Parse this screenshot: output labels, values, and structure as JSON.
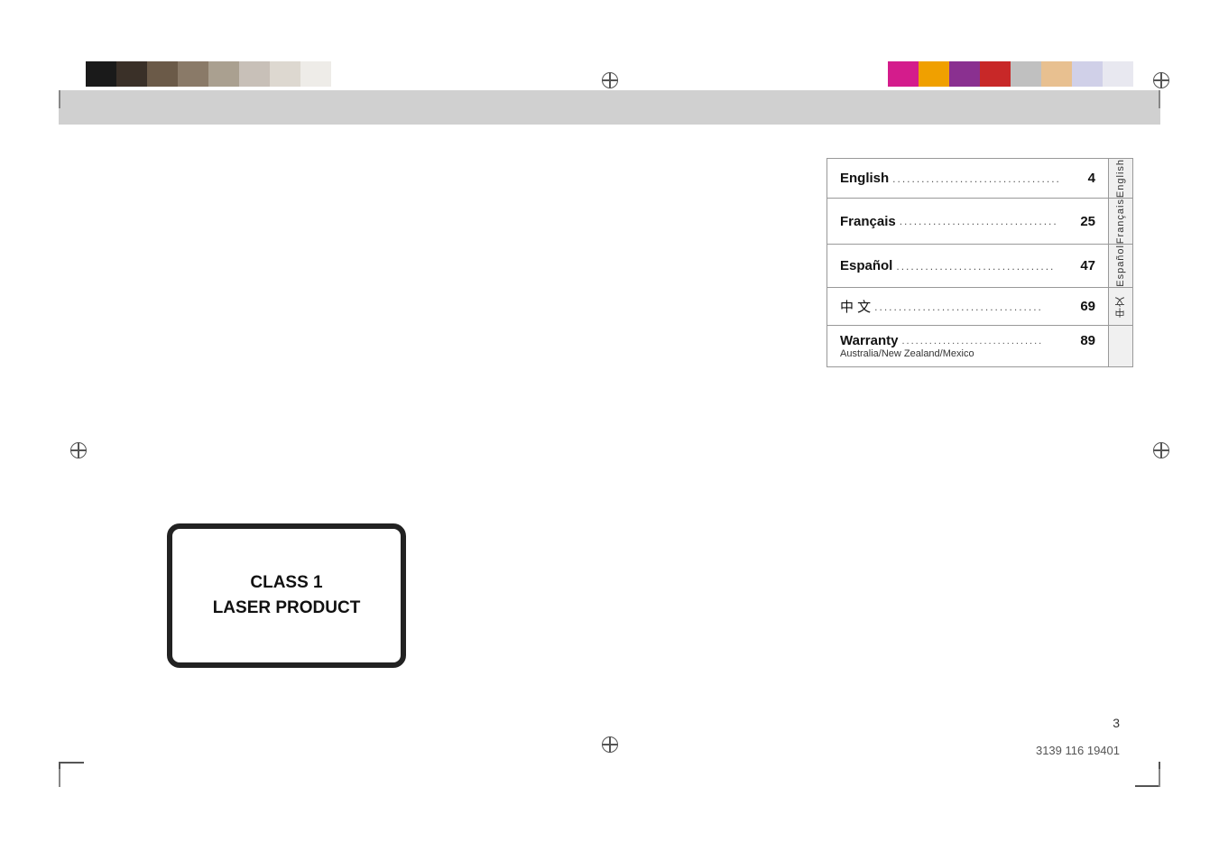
{
  "colors_left": [
    "#1a1a1a",
    "#3a3028",
    "#6b5a48",
    "#8a7a68",
    "#aaa090",
    "#c8c0b8",
    "#ddd8d0",
    "#eeece8"
  ],
  "colors_right": [
    "#d41c8c",
    "#f0a000",
    "#8a3090",
    "#c82828",
    "#c0c0c0",
    "#e8c090",
    "#d0d0e8",
    "#e8e8f0"
  ],
  "toc": {
    "items": [
      {
        "label": "English",
        "dots": ".....................................",
        "page": "4",
        "side": "English"
      },
      {
        "label": "Français",
        "dots": ".................................",
        "page": "25",
        "side": "Français"
      },
      {
        "label": "Español",
        "dots": ".................................",
        "page": "47",
        "side": "Español"
      },
      {
        "label": "中 文",
        "dots": ".......................................",
        "page": "69",
        "side": "中文"
      },
      {
        "label": "Warranty",
        "dots": "...............................",
        "page": "89",
        "sub": "Australia/New Zealand/Mexico",
        "side": ""
      }
    ]
  },
  "laser": {
    "line1": "CLASS 1",
    "line2": "LASER PRODUCT"
  },
  "page_number": "3",
  "part_number": "3139 116 19401"
}
